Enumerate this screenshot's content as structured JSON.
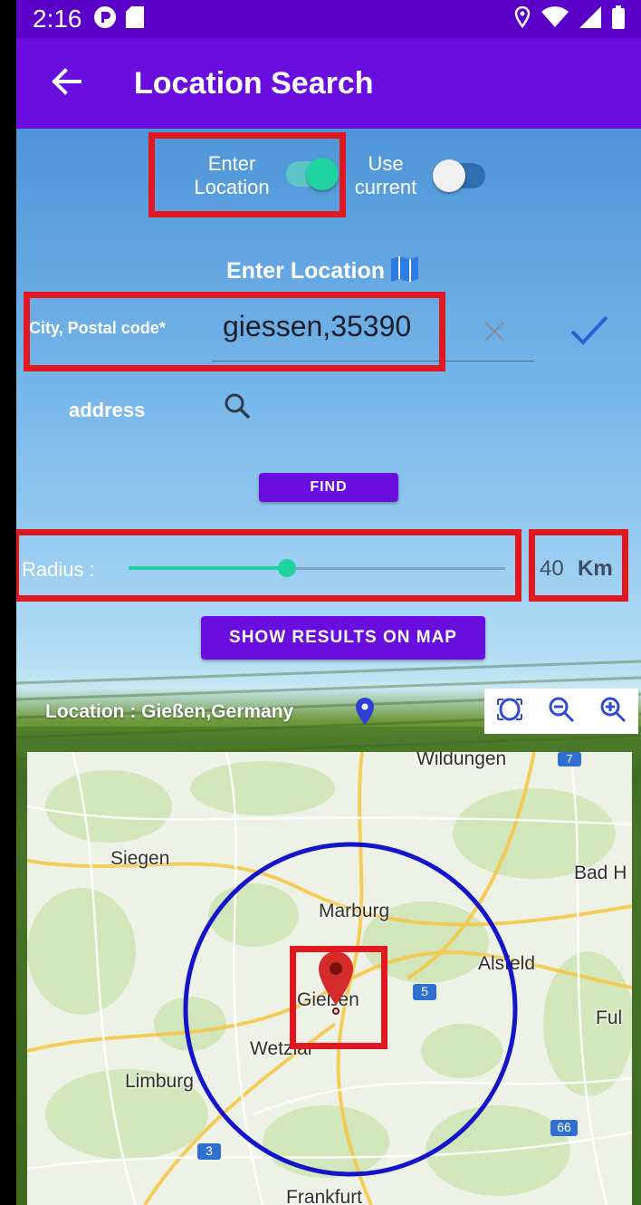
{
  "status": {
    "time": "2:16"
  },
  "appbar": {
    "title": "Location Search"
  },
  "toggles": {
    "enter_location_label": "Enter\nLocation",
    "use_current_label": "Use\ncurrent",
    "enter_location_on": true,
    "use_current_on": false
  },
  "section": {
    "title": "Enter Location"
  },
  "city": {
    "label": "City, Postal code*",
    "value": "giessen,35390"
  },
  "address": {
    "label": "address"
  },
  "buttons": {
    "find": "FIND",
    "show_results": "SHOW RESULTS ON MAP"
  },
  "radius": {
    "label": "Radius :",
    "value": "40",
    "unit": "Km",
    "slider_fraction": 0.42
  },
  "location": {
    "text": "Location : Gießen,Germany"
  },
  "map": {
    "labels": {
      "wildungen": "Wildungen",
      "siegen": "Siegen",
      "bad_h": "Bad H",
      "marburg": "Marburg",
      "alsfeld": "Alsfeld",
      "giessen": "Gießen",
      "ful": "Ful",
      "wetzlar": "Wetzlar",
      "limburg": "Limburg",
      "frankfurt": "Frankfurt"
    },
    "shields": {
      "a7": "7",
      "a5": "5",
      "a66": "66",
      "a3": "3"
    }
  },
  "colors": {
    "primary": "#6a0ddf",
    "accent": "#1fd3a0",
    "circle": "#1414c8",
    "pin": "#d42b2b",
    "highlight": "#e0181f"
  }
}
